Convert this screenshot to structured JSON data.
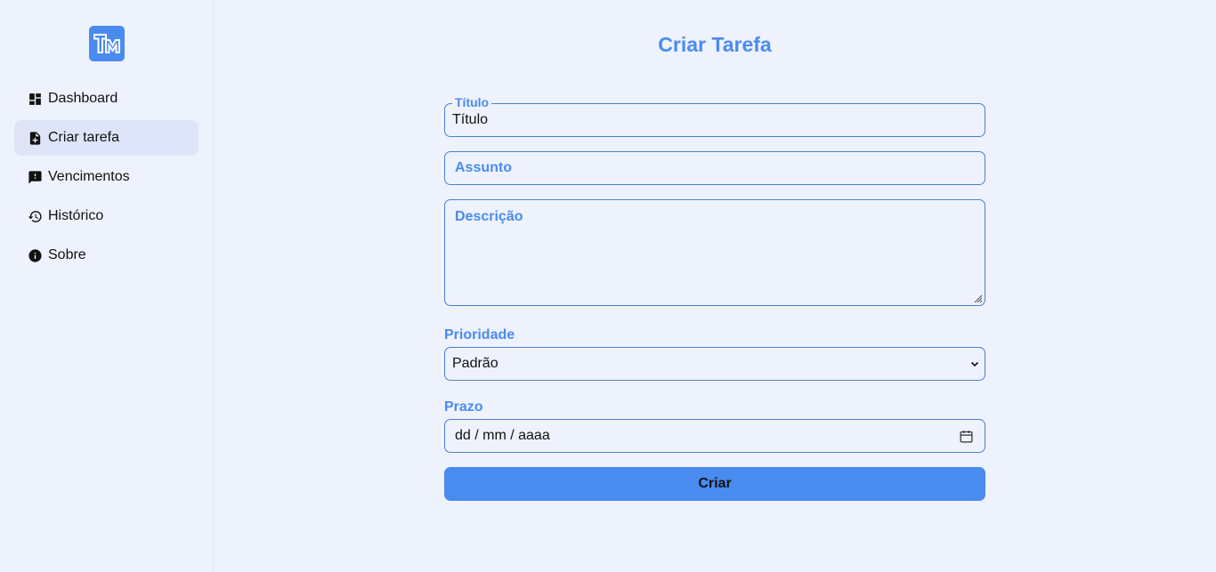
{
  "brand": {
    "logo_text": "TM",
    "accent": "#4a8bef"
  },
  "sidebar": {
    "items": [
      {
        "label": "Dashboard",
        "icon": "dashboard-icon"
      },
      {
        "label": "Criar tarefa",
        "icon": "add-document-icon",
        "active": true
      },
      {
        "label": "Vencimentos",
        "icon": "alert-message-icon"
      },
      {
        "label": "Histórico",
        "icon": "history-icon"
      },
      {
        "label": "Sobre",
        "icon": "info-icon"
      }
    ]
  },
  "form": {
    "title": "Criar Tarefa",
    "titulo": {
      "label": "Título",
      "value": "Título"
    },
    "assunto": {
      "placeholder": "Assunto"
    },
    "descricao": {
      "placeholder": "Descrição"
    },
    "prioridade": {
      "label": "Prioridade",
      "selected": "Padrão"
    },
    "prazo": {
      "label": "Prazo",
      "placeholder": "dd / mm / aaaa"
    },
    "submit_label": "Criar"
  }
}
